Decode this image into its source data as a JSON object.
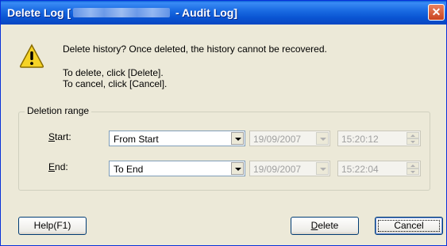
{
  "window": {
    "title_prefix": "Delete Log [",
    "title_suffix": " - Audit Log]",
    "close_glyph": "✕"
  },
  "message": {
    "line1": "Delete history? Once deleted, the history cannot be recovered.",
    "line2": "To delete, click [Delete].",
    "line3": "To cancel, click [Cancel]."
  },
  "deletion_range": {
    "legend": "Deletion range",
    "start": {
      "label_underlined": "S",
      "label_rest": "tart:",
      "selection": "From Start",
      "date": "19/09/2007",
      "time": "15:20:12"
    },
    "end": {
      "label_underlined": "E",
      "label_rest": "nd:",
      "selection": "To End",
      "date": "19/09/2007",
      "time": "15:22:04"
    }
  },
  "buttons": {
    "help": "Help(F1)",
    "delete_underlined": "D",
    "delete_rest": "elete",
    "cancel": "Cancel"
  },
  "colors": {
    "titlebar": "#0a55d3",
    "dialog_bg": "#ece9d8",
    "close_button": "#c9431f"
  },
  "icons": {
    "warning": "warning-icon",
    "close": "close-icon",
    "dropdown": "chevron-down-icon"
  }
}
